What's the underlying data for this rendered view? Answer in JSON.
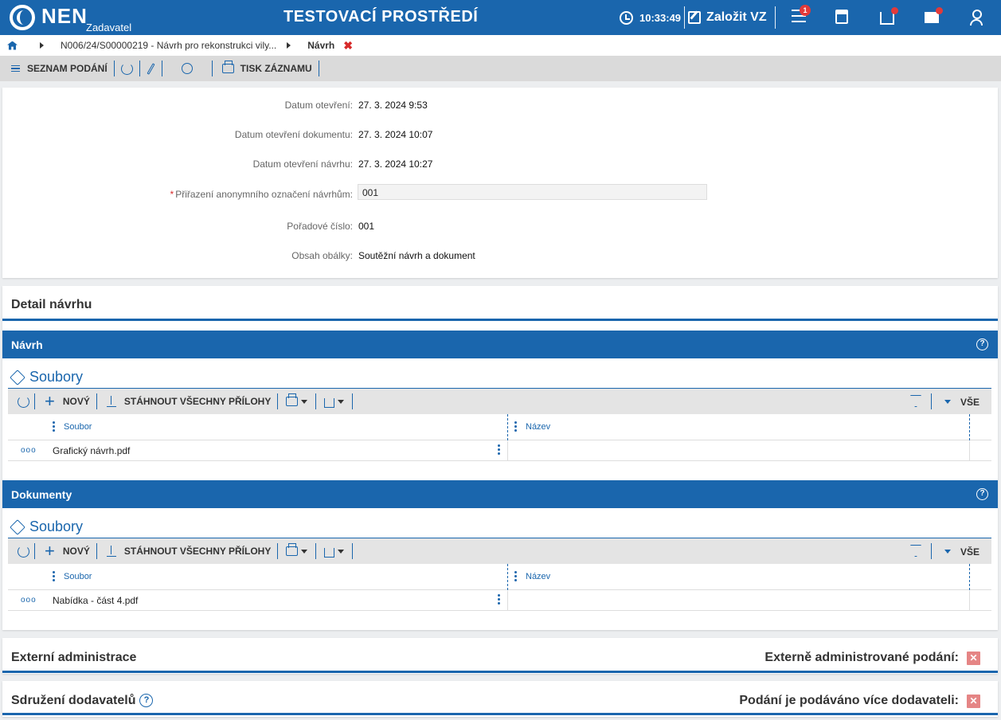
{
  "header": {
    "logo_text": "NEN",
    "logo_sub": "Zadavatel",
    "environment": "TESTOVACÍ PROSTŘEDÍ",
    "time": "10:33:49",
    "create_label": "Založit VZ",
    "notifications_count": "1"
  },
  "breadcrumb": {
    "item1": "N006/24/S00000219 - Návrh pro rekonstrukci vily...",
    "current": "Návrh",
    "close": "✖"
  },
  "toolbar": {
    "list_label": "SEZNAM PODÁNÍ",
    "print_label": "TISK ZÁZNAMU"
  },
  "info": {
    "rows": [
      {
        "label": "Datum otevření:",
        "value": "27. 3. 2024 9:53"
      },
      {
        "label": "Datum otevření dokumentu:",
        "value": "27. 3. 2024 10:07"
      },
      {
        "label": "Datum otevření návrhu:",
        "value": "27. 3. 2024 10:27"
      },
      {
        "label": "Přiřazení anonymního označení návrhům:",
        "value": "001",
        "required": true
      },
      {
        "label": "Pořadové číslo:",
        "value": "001"
      },
      {
        "label": "Obsah obálky:",
        "value": "Soutěžní návrh a dokument"
      }
    ]
  },
  "detail": {
    "title": "Detail návrhu"
  },
  "navrh": {
    "title": "Návrh",
    "files_title": "Soubory",
    "new_label": "NOVÝ",
    "download_label": "STÁHNOUT VŠECHNY PŘÍLOHY",
    "filter_all": "VŠE",
    "columns": [
      "Soubor",
      "Název"
    ],
    "rows": [
      {
        "soubor": "Grafický návrh.pdf",
        "nazev": ""
      }
    ]
  },
  "dokumenty": {
    "title": "Dokumenty",
    "files_title": "Soubory",
    "new_label": "NOVÝ",
    "download_label": "STÁHNOUT VŠECHNY PŘÍLOHY",
    "filter_all": "VŠE",
    "columns": [
      "Soubor",
      "Název"
    ],
    "rows": [
      {
        "soubor": "Nabídka - část 4.pdf",
        "nazev": ""
      }
    ]
  },
  "external": {
    "title": "Externí administrace",
    "right_label": "Externě administrované podání:",
    "value_icon": "✕"
  },
  "association": {
    "title": "Sdružení dodavatelů",
    "right_label": "Podání je podáváno více dodavateli:",
    "value_icon": "✕"
  },
  "colors": {
    "brand": "#1a66ad",
    "danger": "#e23a3a",
    "toolbar_bg": "#dadada"
  }
}
